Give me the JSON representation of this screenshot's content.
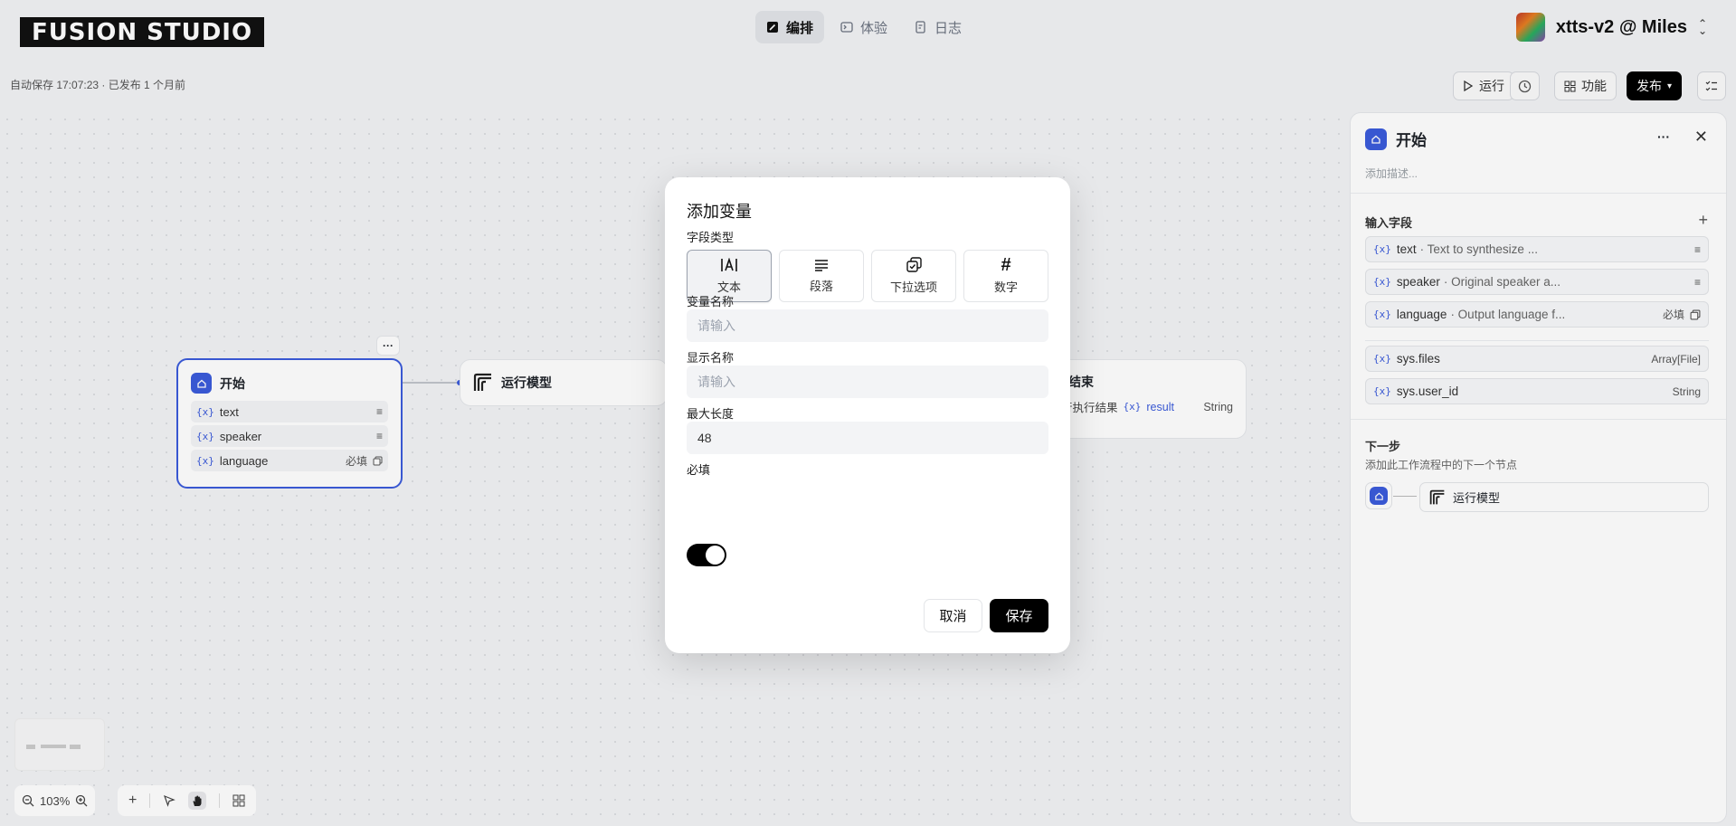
{
  "app": {
    "logo_text": "FUSION STUDIO"
  },
  "topnav": {
    "tabs": [
      {
        "label": "编排",
        "icon": "edit-icon",
        "active": true
      },
      {
        "label": "体验",
        "icon": "terminal-icon",
        "active": false
      },
      {
        "label": "日志",
        "icon": "log-icon",
        "active": false
      }
    ],
    "project_name": "xtts-v2 @ Miles"
  },
  "subbar": {
    "autosave": "自动保存 17:07:23 · 已发布 1 个月前",
    "run_label": "运行",
    "features_label": "功能",
    "publish_label": "发布"
  },
  "canvas": {
    "start_node": {
      "title": "开始",
      "vars": [
        {
          "name": "text",
          "badge": ""
        },
        {
          "name": "speaker",
          "badge": ""
        },
        {
          "name": "language",
          "badge": "必填"
        }
      ]
    },
    "model_node": {
      "title": "运行模型"
    },
    "end_node": {
      "title": "结束",
      "output_desc": "行执行结果",
      "output_var": "result",
      "output_type": "String"
    },
    "zoom": "103%"
  },
  "panel": {
    "title": "开始",
    "desc_placeholder": "添加描述...",
    "input_section": "输入字段",
    "fields": [
      {
        "name": "text",
        "desc": "· Text to synthesize ...",
        "right": ""
      },
      {
        "name": "speaker",
        "desc": "· Original speaker a...",
        "right": ""
      },
      {
        "name": "language",
        "desc": "· Output language f...",
        "right": "必填"
      }
    ],
    "sys_fields": [
      {
        "name": "sys.files",
        "type": "Array[File]"
      },
      {
        "name": "sys.user_id",
        "type": "String"
      }
    ],
    "next_section": "下一步",
    "next_desc": "添加此工作流程中的下一个节点",
    "next_node": "运行模型"
  },
  "modal": {
    "title": "添加变量",
    "field_type_label": "字段类型",
    "types": [
      {
        "label": "文本",
        "icon": "text-input-icon",
        "selected": true
      },
      {
        "label": "段落",
        "icon": "paragraph-icon",
        "selected": false
      },
      {
        "label": "下拉选项",
        "icon": "select-icon",
        "selected": false
      },
      {
        "label": "数字",
        "icon": "number-icon",
        "selected": false
      }
    ],
    "var_name_label": "变量名称",
    "var_name_placeholder": "请输入",
    "display_name_label": "显示名称",
    "display_name_placeholder": "请输入",
    "max_length_label": "最大长度",
    "max_length_value": "48",
    "required_label": "必填",
    "required_on": true,
    "cancel_label": "取消",
    "save_label": "保存"
  },
  "colors": {
    "accent": "#3b5bdb",
    "primary_button": "#000000"
  }
}
